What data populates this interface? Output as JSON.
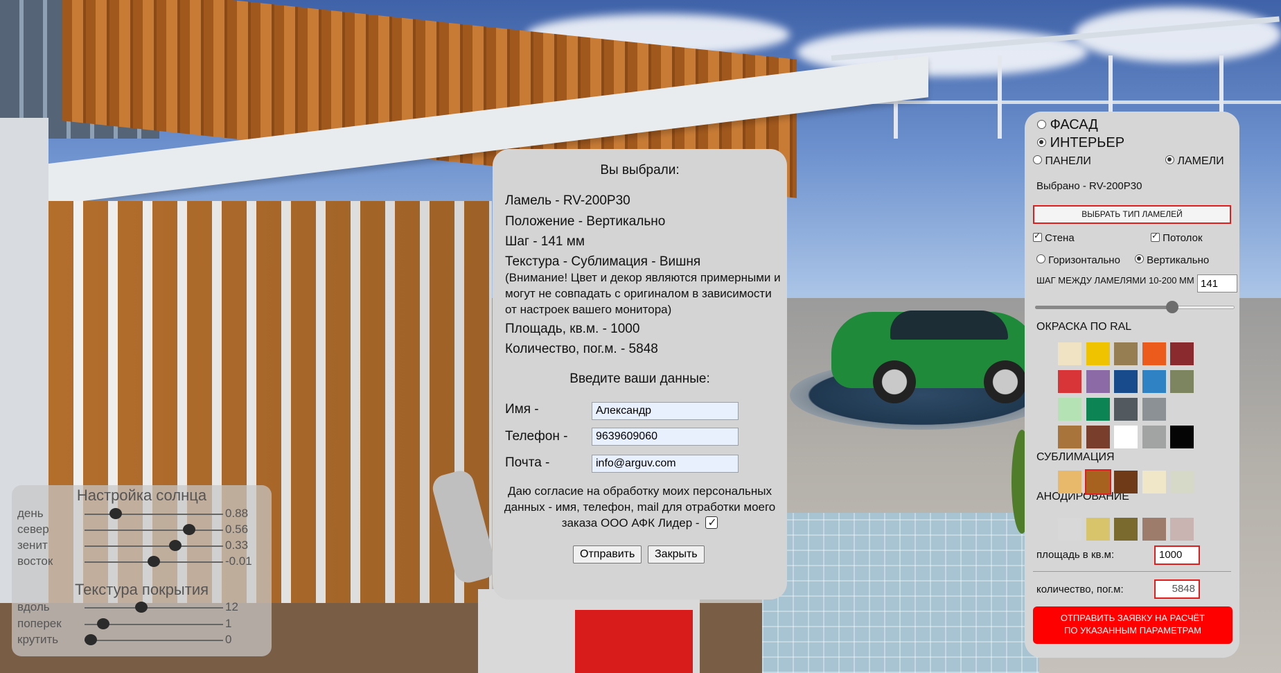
{
  "sun_panel": {
    "title": "Настройка солнца",
    "sun_sliders": [
      {
        "label": "день",
        "value": "0.88",
        "level": 0.2
      },
      {
        "label": "север",
        "value": "0.56",
        "level": 0.78
      },
      {
        "label": "зенит",
        "value": "0.33",
        "level": 0.67
      },
      {
        "label": "восток",
        "value": "-0.01",
        "level": 0.5
      }
    ],
    "texture_title": "Текстура покрытия",
    "texture_sliders": [
      {
        "label": "вдоль",
        "value": "12",
        "level": 0.4
      },
      {
        "label": "поперек",
        "value": "1",
        "level": 0.1
      },
      {
        "label": "крутить",
        "value": "0",
        "level": 0.0
      }
    ]
  },
  "order_dialog": {
    "title": "Вы выбрали:",
    "lamel": "Ламель - RV-200P30",
    "position": "Положение - Вертикально",
    "step": "Шаг - 141 мм",
    "texture": "Текстура - Сублимация - Вишня",
    "warning": "(Внимание! Цвет и декор являются примерными и могут не совпадать с оригиналом в зависимости от настроек вашего монитора)",
    "area": "Площадь, кв.м. - 1000",
    "quantity": "Количество, пог.м. - 5848",
    "enter_data": "Введите ваши данные:",
    "name_label": "Имя -",
    "name_value": "Александр",
    "phone_label": "Телефон -",
    "phone_value": "9639609060",
    "email_label": "Почта -",
    "email_value": "info@arguv.com",
    "consent_text": "Даю согласие на обработку моих персональных данных - имя, телефон, mail для отработки моего заказа ООО АФК Лидер -",
    "consent_checked": true,
    "submit_label": "Отправить",
    "close_label": "Закрыть"
  },
  "config_panel": {
    "facade_label": "ФАСАД",
    "interior_label": "ИНТЕРЬЕР",
    "panels_label": "ПАНЕЛИ",
    "lamels_label": "ЛАМЕЛИ",
    "selected_text": "Выбрано - RV-200P30",
    "choose_type_label": "ВЫБРАТЬ ТИП ЛАМЕЛЕЙ",
    "wall_label": "Стена",
    "ceiling_label": "Потолок",
    "horizontal_label": "Горизонтально",
    "vertical_label": "Вертикально",
    "step_label": "ШАГ МЕЖДУ ЛАМЕЛЯМИ 10-200 ММ",
    "step_value": "141",
    "step_level": 0.7,
    "ral_title": "ОКРАСКА ПО RAL",
    "ral_colors": [
      "#efe3c4",
      "#efc300",
      "#967d52",
      "#ec5b1b",
      "#8a2a2e",
      "#d73538",
      "#8c6aa6",
      "#174b8b",
      "#2f82c3",
      "#7c8560",
      "#b4e2b4",
      "#0d8454",
      "#525a60",
      "#8c9196",
      "#a8743c",
      "#7a3f2c",
      "#ffffff",
      "#a2a4a4",
      "#050505"
    ],
    "sublimation_title": "СУБЛИМАЦИЯ",
    "sublimation_swatches": [
      "#e8b96a",
      "#a8621f",
      "#6e3a17",
      "#efe7c8",
      "#d6d8c8"
    ],
    "anodizing_title": "АНОДИРОВАНИЕ",
    "anodizing_swatches": [
      "#d8d8d8",
      "#d8c46a",
      "#7a6a2e",
      "#9d7c6c",
      "#c9b4b2"
    ],
    "area_label": "площадь в кв.м:",
    "area_value": "1000",
    "quantity_label": "количество, пог.м:",
    "quantity_value": "5848",
    "send_line1": "ОТПРАВИТЬ ЗАЯВКУ НА РАСЧЁТ",
    "send_line2": "ПО УКАЗАННЫМ ПАРАМЕТРАМ"
  }
}
